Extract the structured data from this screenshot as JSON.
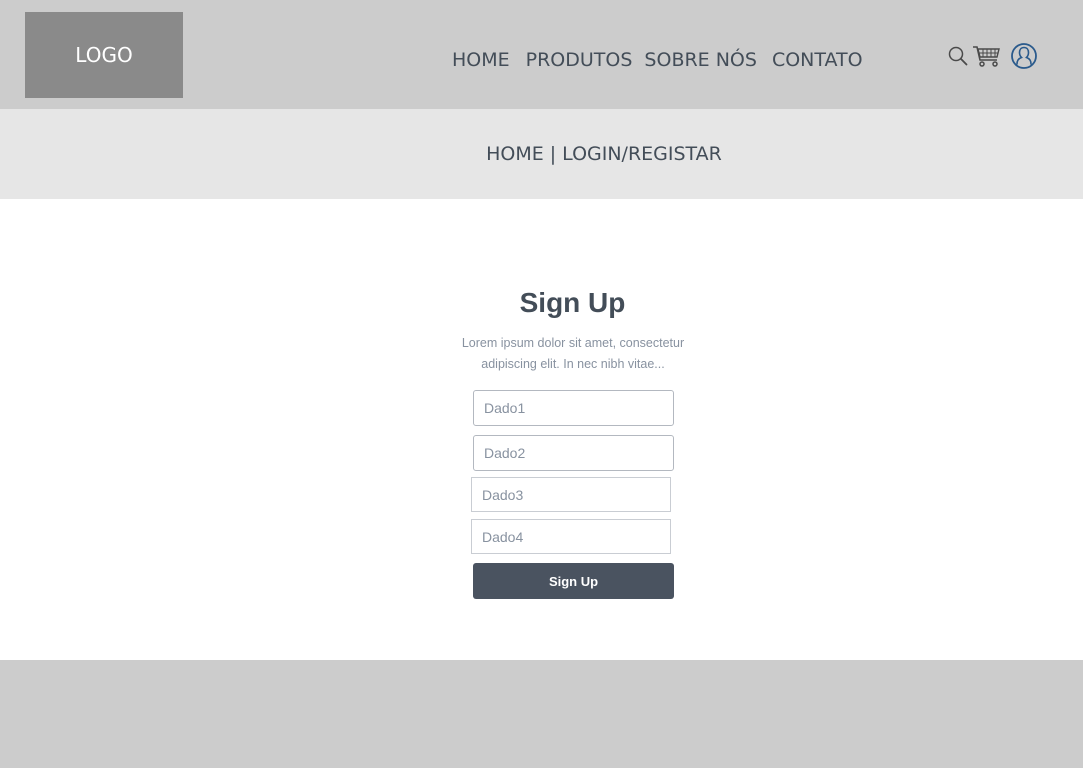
{
  "header": {
    "logo": "LOGO",
    "nav": [
      "HOME",
      "PRODUTOS",
      "SOBRE NÓS",
      "CONTATO"
    ],
    "icons": [
      "search-icon",
      "cart-icon",
      "user-icon"
    ]
  },
  "breadcrumb": {
    "home": "HOME",
    "separator": "|",
    "current": "LOGIN/REGISTAR"
  },
  "form": {
    "title": "Sign Up",
    "description": "Lorem ipsum dolor sit amet, consectetur adipiscing elit. In nec nibh vitae...",
    "fields": [
      {
        "placeholder": "Dado1"
      },
      {
        "placeholder": "Dado2"
      },
      {
        "placeholder": "Dado3"
      },
      {
        "placeholder": "Dado4"
      }
    ],
    "submit_label": "Sign Up"
  },
  "colors": {
    "header_bg": "#cccccc",
    "breadcrumb_bg": "#e6e6e6",
    "logo_bg": "#8a8a8a",
    "text_dark": "#434d58",
    "button_bg": "#4a5360",
    "user_icon": "#2a5a8c"
  }
}
